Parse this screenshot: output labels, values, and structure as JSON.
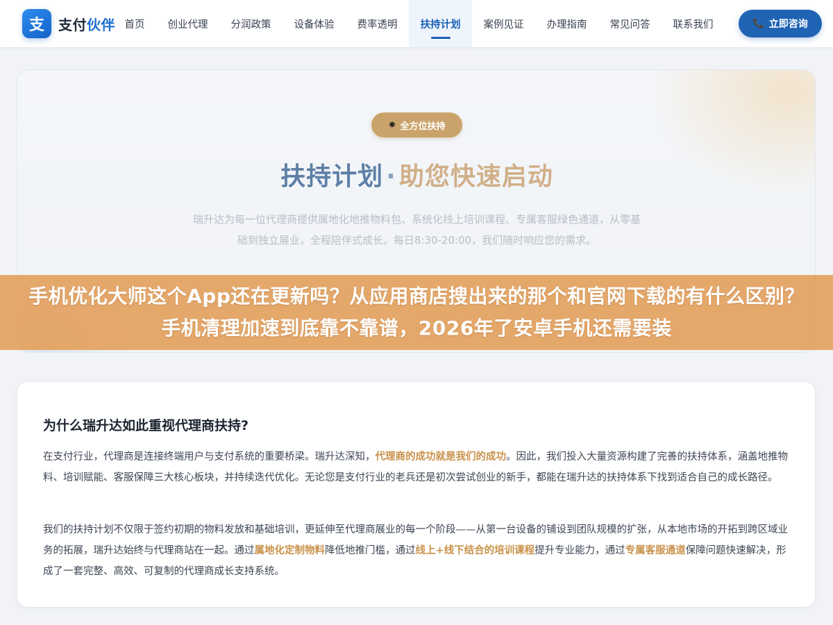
{
  "brand": {
    "mark": "支",
    "name_part1": "支付",
    "name_part2": "伙伴"
  },
  "nav": {
    "items": [
      {
        "label": "首页",
        "active": false
      },
      {
        "label": "创业代理",
        "active": false
      },
      {
        "label": "分润政策",
        "active": false
      },
      {
        "label": "设备体验",
        "active": false
      },
      {
        "label": "费率透明",
        "active": false
      },
      {
        "label": "扶持计划",
        "active": true
      },
      {
        "label": "案例见证",
        "active": false
      },
      {
        "label": "办理指南",
        "active": false
      },
      {
        "label": "常见问答",
        "active": false
      },
      {
        "label": "联系我们",
        "active": false
      }
    ],
    "cta_label": "立即咨询",
    "cta_icon": "phone-icon"
  },
  "hero": {
    "badge_icon": "sparkle-icon",
    "badge_label": "全方位扶持",
    "title_main": "扶持计划",
    "title_separator": "·",
    "title_highlight": "助您快速启动",
    "description": "瑞升达为每一位代理商提供属地化地推物料包、系统化线上培训课程、专属客服绿色通道，从零基础到独立展业，全程陪伴式成长。每日8:30-20:00，我们随时响应您的需求。"
  },
  "overlay": {
    "text": "手机优化大师这个App还在更新吗？从应用商店搜出来的那个和官网下载的有什么区别？手机清理加速到底靠不靠谱，2026年了安卓手机还需要装"
  },
  "content": {
    "heading": "为什么瑞升达如此重视代理商扶持?",
    "para1": {
      "part1": "在支付行业，代理商是连接终端用户与支付系统的重要桥梁。瑞升达深知，",
      "highlight1": "代理商的成功就是我们的成功",
      "part2": "。因此，我们投入大量资源构建了完善的扶持体系，涵盖地推物料、培训赋能、客服保障三大核心板块，并持续迭代优化。无论您是支付行业的老兵还是初次尝试创业的新手，都能在瑞升达的扶持体系下找到适合自己的成长路径。"
    },
    "para2": {
      "part1": "我们的扶持计划不仅限于签约初期的物料发放和基础培训，更延伸至代理商展业的每一个阶段——从第一台设备的铺设到团队规模的扩张，从本地市场的开拓到跨区域业务的拓展，瑞升达始终与代理商站在一起。通过",
      "highlight1": "属地化定制物料",
      "part2": "降低地推门槛，通过",
      "highlight2": "线上+线下结合的培训课程",
      "part3": "提升专业能力，通过",
      "highlight3": "专属客服通道",
      "part4": "保障问题快速解决，形成了一套完整、高效、可复制的代理商成长支持系统。"
    }
  },
  "colors": {
    "primary": "#1f63b5",
    "active_nav": "#1a5fb4",
    "gold": "#caa36b",
    "highlight": "#c9924a",
    "overlay": "#e4a160"
  }
}
